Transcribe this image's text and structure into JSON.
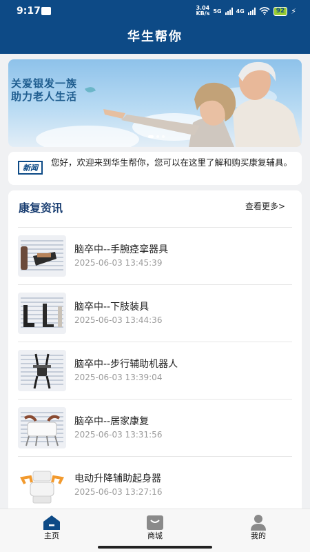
{
  "status_bar": {
    "time": "9:17",
    "net_speed_value": "3.04",
    "net_speed_unit": "KB/s",
    "net_type_1": "5G",
    "net_type_2": "4G",
    "battery": "92"
  },
  "header": {
    "title": "华生帮你"
  },
  "banner": {
    "line1": "关爱银发一族",
    "line2": "助力老人生活",
    "slide_count": 3,
    "active_slide": 1
  },
  "notice": {
    "badge": "新闻",
    "text": "您好，欢迎来到华生帮你，您可以在这里了解和购买康复辅具。"
  },
  "info": {
    "title": "康复资讯",
    "more": "查看更多>",
    "articles": [
      {
        "title": "脑卒中--手腕痉挛器具",
        "time": "2025-06-03 13:45:39"
      },
      {
        "title": "脑卒中--下肢装具",
        "time": "2025-06-03 13:44:36"
      },
      {
        "title": "脑卒中--步行辅助机器人",
        "time": "2025-06-03 13:39:04"
      },
      {
        "title": "脑卒中--居家康复",
        "time": "2025-06-03 13:31:56"
      },
      {
        "title": "电动升降辅助起身器",
        "time": "2025-06-03 13:27:16"
      }
    ]
  },
  "tabbar": {
    "items": [
      {
        "label": "主页",
        "icon": "home-icon",
        "active": true
      },
      {
        "label": "商城",
        "icon": "shop-icon",
        "active": false
      },
      {
        "label": "我的",
        "icon": "user-icon",
        "active": false
      }
    ],
    "active_color": "#0d4a86",
    "inactive_color": "#8a8a8a"
  },
  "colors": {
    "brand": "#0d4a86",
    "title": "#1b3f72"
  }
}
